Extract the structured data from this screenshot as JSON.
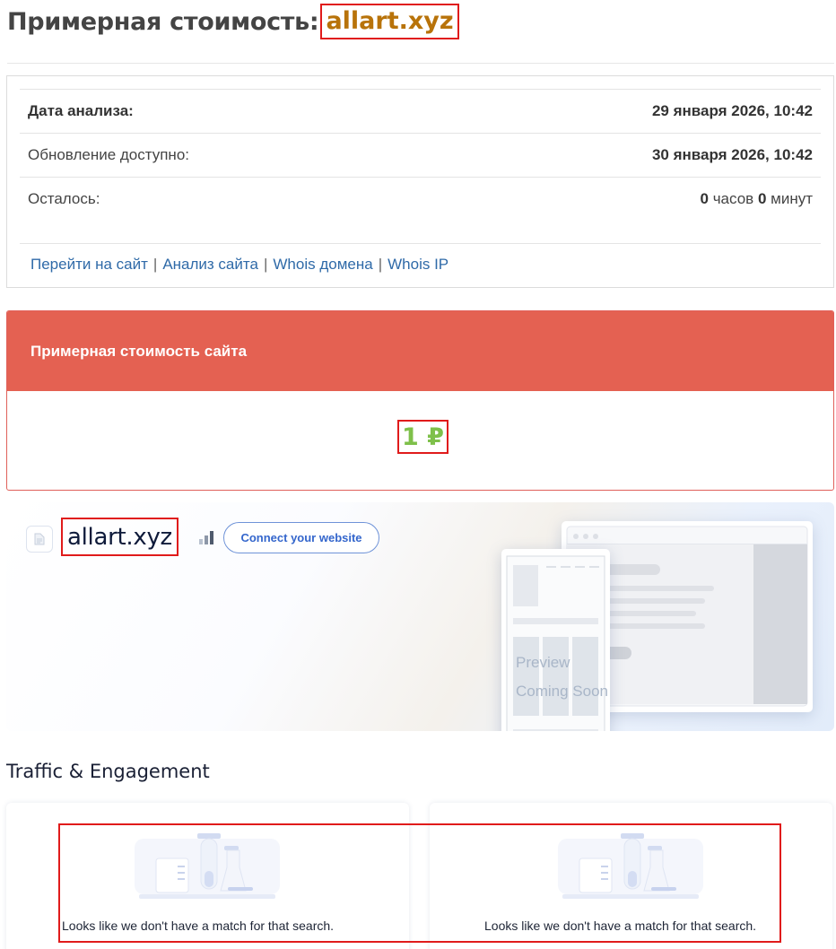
{
  "header": {
    "title_prefix": "Примерная стоимость:",
    "domain": "allart.xyz"
  },
  "info": {
    "rows": [
      {
        "label": "Дата анализа:",
        "value": "29 января 2026, 10:42"
      },
      {
        "label": "Обновление доступно:",
        "value": "30 января 2026, 10:42"
      }
    ],
    "remaining_label": "Осталось:",
    "remaining": {
      "hours": "0",
      "hours_unit": "часов",
      "minutes": "0",
      "minutes_unit": "минут"
    },
    "links": [
      "Перейти на сайт",
      "Анализ сайта",
      "Whois домена",
      "Whois IP"
    ],
    "link_separator": "|"
  },
  "cost": {
    "header": "Примерная стоимость сайта",
    "value": "1 ₽"
  },
  "preview": {
    "site_name": "allart.xyz",
    "connect_button": "Connect your website",
    "preview_text_1": "Preview",
    "preview_text_2": "Coming Soon"
  },
  "traffic": {
    "heading": "Traffic & Engagement",
    "cards": [
      {
        "message": "Looks like we don't have a match for that search."
      },
      {
        "message": "Looks like we don't have a match for that search."
      }
    ]
  },
  "colors": {
    "accent_red": "#e46152",
    "domain_orange": "#b8730a",
    "price_green": "#7ec04a",
    "link_blue": "#2f6aa8",
    "highlight_border": "#e01b1b"
  }
}
